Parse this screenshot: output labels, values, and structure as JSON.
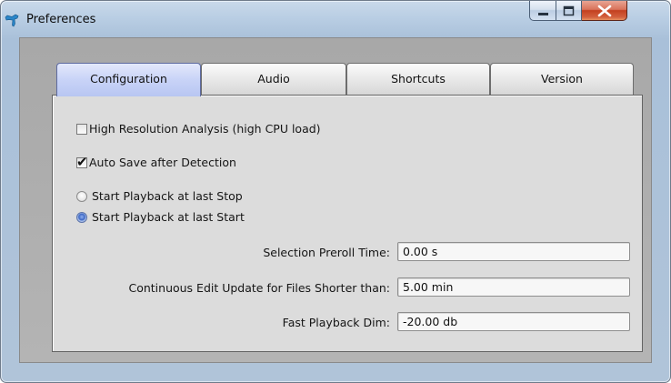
{
  "window": {
    "title": "Preferences",
    "icon": "app-logo-icon",
    "controls": {
      "minimize": "minimize-icon",
      "maximize": "maximize-icon",
      "close": "close-icon"
    }
  },
  "tabs": [
    {
      "label": "Configuration",
      "active": true
    },
    {
      "label": "Audio",
      "active": false
    },
    {
      "label": "Shortcuts",
      "active": false
    },
    {
      "label": "Version",
      "active": false
    }
  ],
  "configuration": {
    "checkboxes": [
      {
        "label": "High Resolution Analysis (high CPU load)",
        "checked": false
      },
      {
        "label": "Auto Save after Detection",
        "checked": true
      }
    ],
    "playback_radios": [
      {
        "label": "Start Playback at last Stop",
        "selected": false
      },
      {
        "label": "Start Playback at last Start",
        "selected": true
      }
    ],
    "fields": [
      {
        "label": "Selection Preroll Time:",
        "value": "0.00 s"
      },
      {
        "label": "Continuous Edit Update for Files Shorter than:",
        "value": "5.00 min"
      },
      {
        "label": "Fast Playback Dim:",
        "value": "-20.00 db"
      }
    ]
  }
}
